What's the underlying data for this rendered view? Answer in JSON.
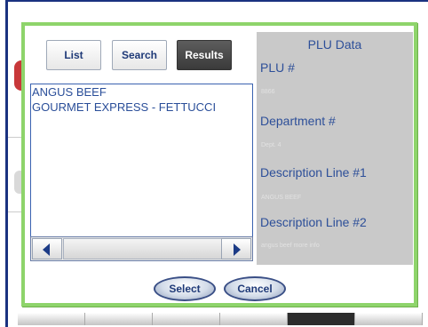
{
  "tabs": {
    "list": "List",
    "search": "Search",
    "results": "Results"
  },
  "results": {
    "items": [
      "ANGUS BEEF",
      "GOURMET EXPRESS - FETTUCCI"
    ]
  },
  "plu_panel": {
    "title": "PLU Data",
    "plu_label": "PLU #",
    "plu_value": "8866",
    "department_label": "Department #",
    "department_value": "Dept. 4",
    "desc1_label": "Description Line #1",
    "desc1_value": "ANGUS BEEF",
    "desc2_label": "Description Line #2",
    "desc2_value": "angus beef more info"
  },
  "actions": {
    "select": "Select",
    "cancel": "Cancel"
  },
  "colors": {
    "dialog_border": "#8ed46b",
    "text_blue": "#2d4f99",
    "panel_gray": "#c9c9c9"
  }
}
